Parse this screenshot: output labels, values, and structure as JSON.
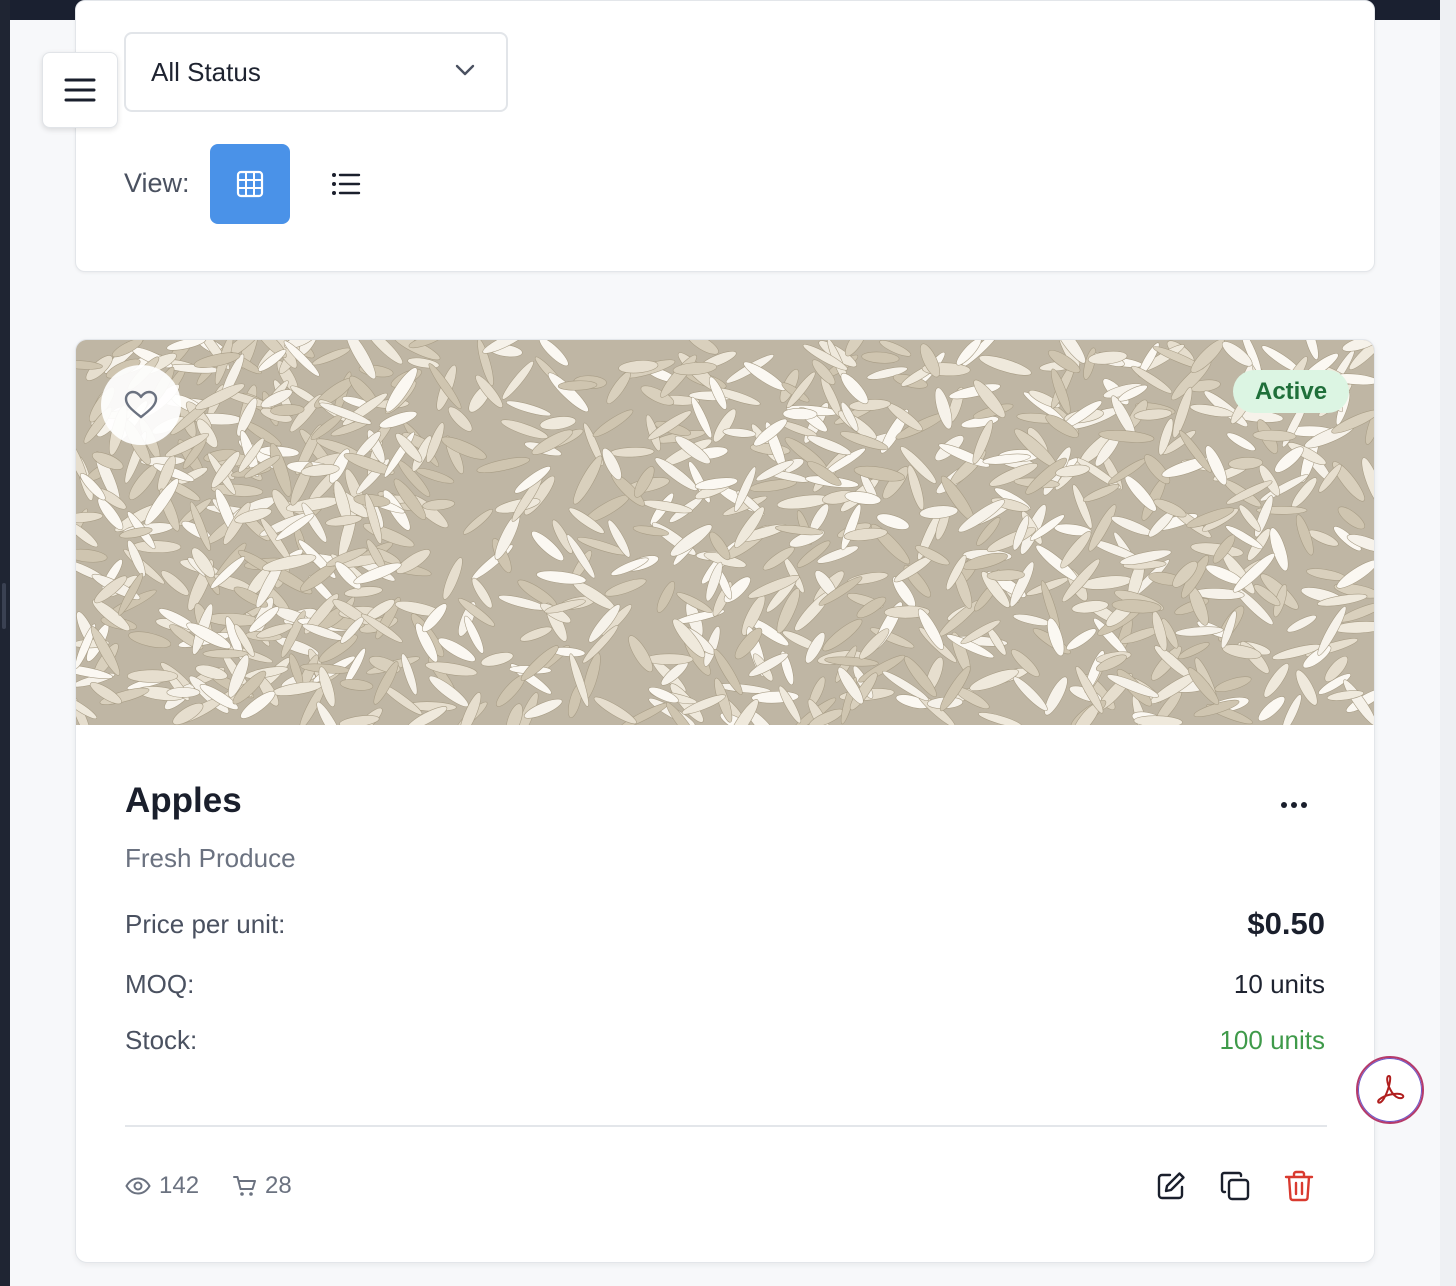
{
  "filters": {
    "status_select": {
      "value": "All Status"
    },
    "view": {
      "label": "View:",
      "active": "grid"
    }
  },
  "product": {
    "name": "Apples",
    "category": "Fresh Produce",
    "status": "Active",
    "price_label": "Price per unit:",
    "price_value": "$0.50",
    "moq_label": "MOQ:",
    "moq_value": "10 units",
    "stock_label": "Stock:",
    "stock_value": "100 units",
    "views": "142",
    "carts": "28"
  },
  "colors": {
    "accent": "#4a92e8",
    "active_badge_bg": "#dcf5e3",
    "active_badge_text": "#1f6f3a",
    "stock_green": "#3f9a4a",
    "delete_red": "#d93a2f"
  },
  "icons": [
    "menu-icon",
    "chevron-down-icon",
    "grid-icon",
    "list-icon",
    "heart-icon",
    "more-icon",
    "eye-icon",
    "cart-icon",
    "edit-icon",
    "duplicate-icon",
    "trash-icon",
    "pdf-icon"
  ]
}
